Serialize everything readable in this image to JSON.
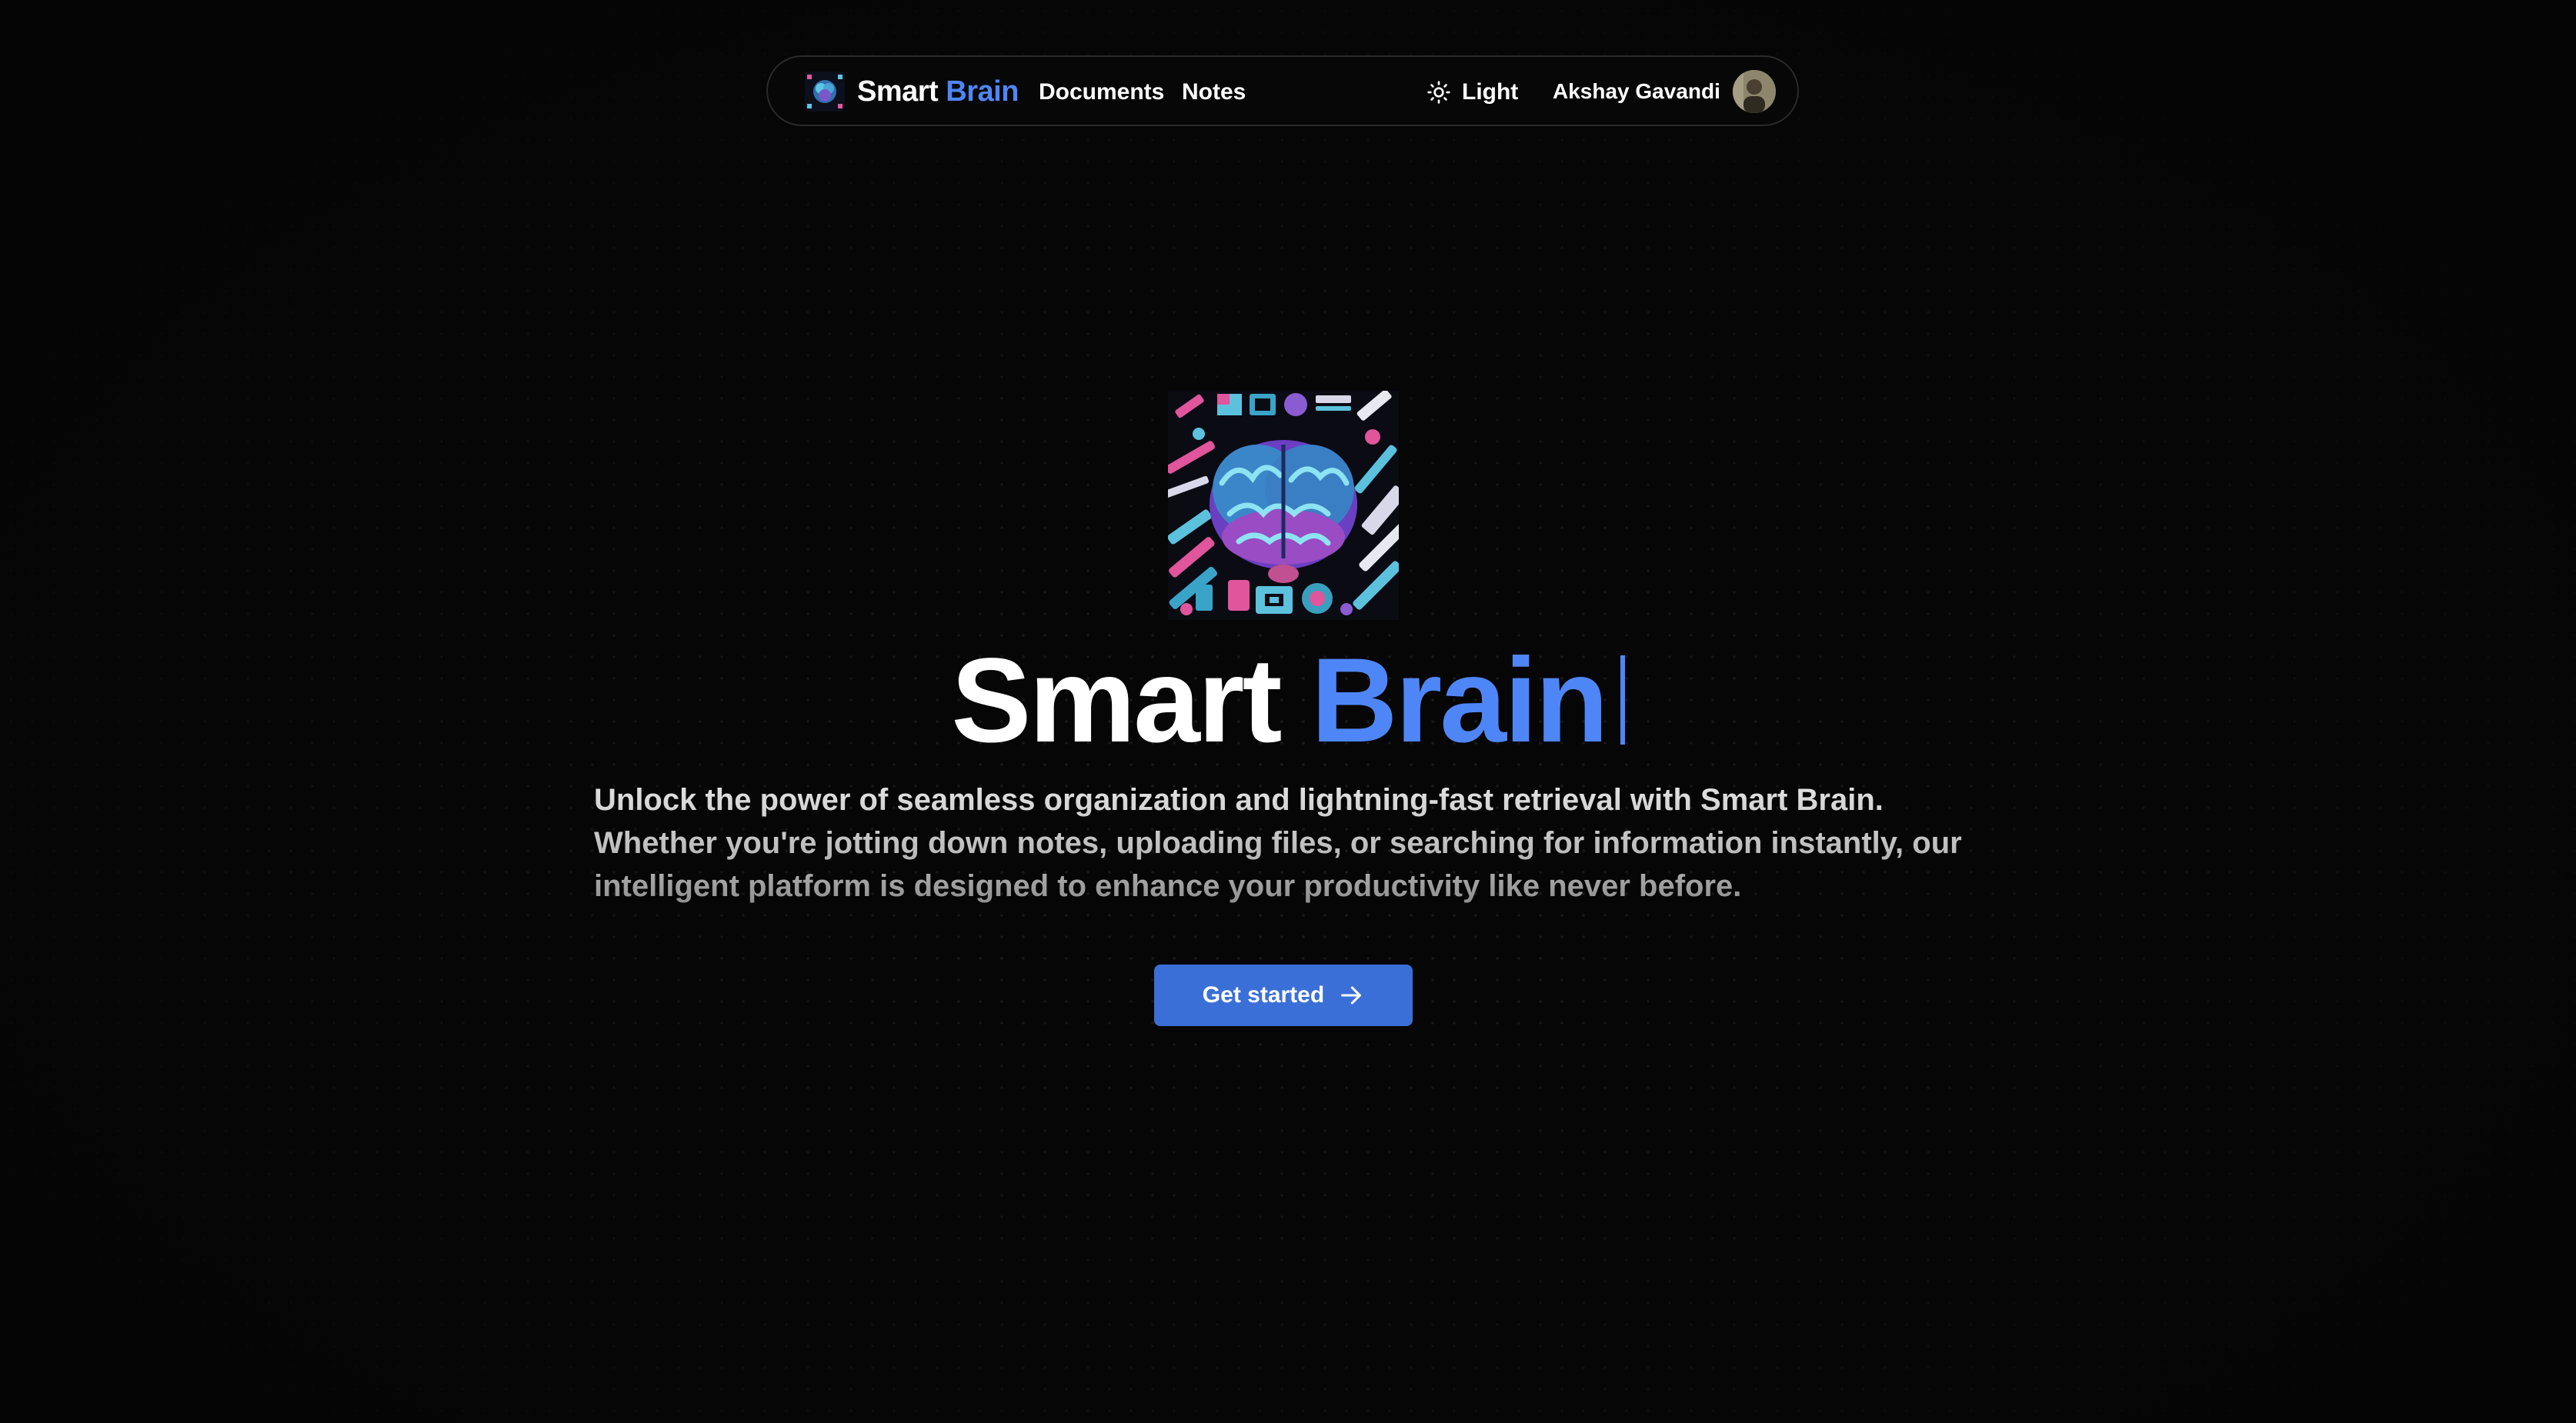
{
  "navbar": {
    "brand": {
      "first": "Smart",
      "second": "Brain",
      "logo_icon": "brain-logo-icon"
    },
    "links": [
      {
        "label": "Documents"
      },
      {
        "label": "Notes"
      }
    ],
    "theme_toggle": {
      "label": "Light",
      "icon": "sun-icon"
    },
    "user": {
      "name": "Akshay Gavandi",
      "icon": "avatar"
    }
  },
  "hero": {
    "image_icon": "brain-illustration",
    "title_first": "Smart",
    "title_second": "Brain",
    "description": "Unlock the power of seamless organization and lightning-fast retrieval with Smart Brain. Whether you're jotting down notes, uploading files, or searching for information instantly, our intelligent platform is designed to enhance your productivity like never before.",
    "cta": {
      "label": "Get started",
      "icon": "arrow-right-icon"
    }
  },
  "colors": {
    "background": "#060606",
    "accent": "#4f86f7",
    "button": "#3b6fd8",
    "text": "#ffffff"
  }
}
